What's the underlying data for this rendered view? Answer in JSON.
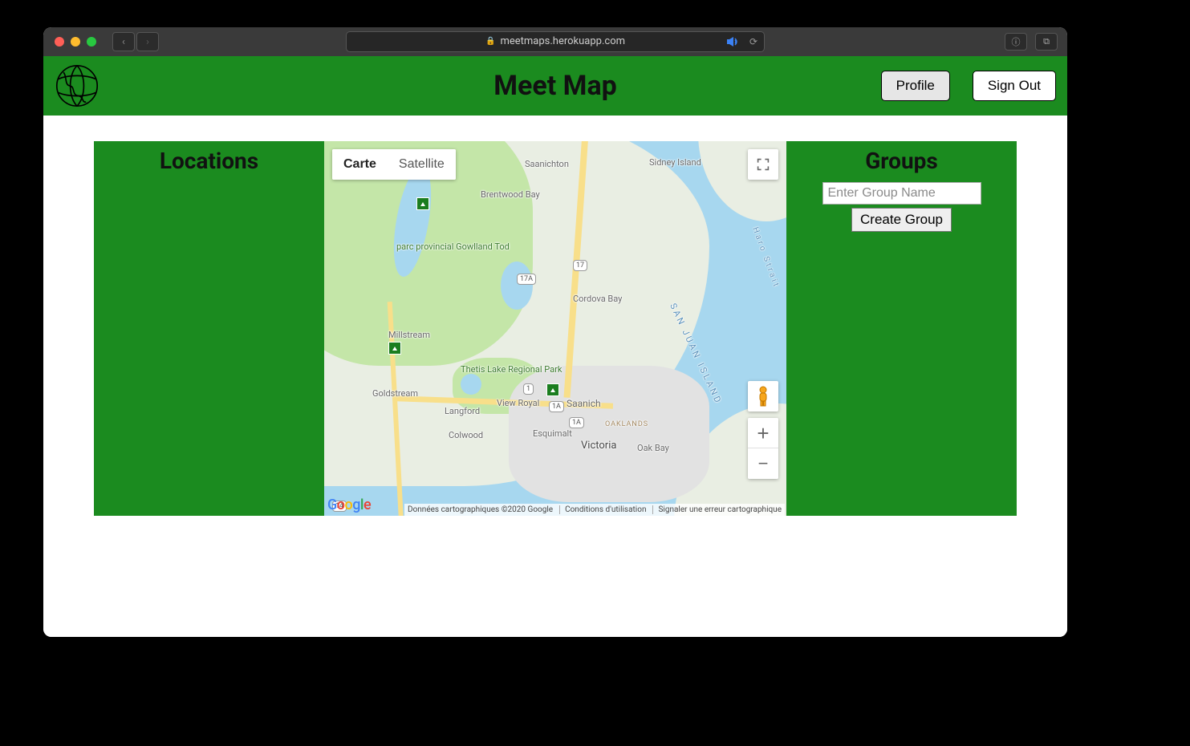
{
  "browser": {
    "url": "meetmaps.herokuapp.com"
  },
  "header": {
    "title": "Meet Map",
    "profile_label": "Profile",
    "signout_label": "Sign Out"
  },
  "left_panel": {
    "title": "Locations"
  },
  "right_panel": {
    "title": "Groups",
    "input_placeholder": "Enter Group Name",
    "create_label": "Create Group"
  },
  "map": {
    "type_map": "Carte",
    "type_sat": "Satellite",
    "zoom_in": "+",
    "zoom_out": "−",
    "attribution": "Données cartographiques ©2020 Google",
    "terms": "Conditions d'utilisation",
    "report": "Signaler une erreur cartographique",
    "labels": {
      "saanichton": "Saanichton",
      "sidney_island": "Sidney Island",
      "brentwood": "Brentwood Bay",
      "gowlland": "parc provincial Gowlland Tod",
      "cordova": "Cordova Bay",
      "millstream": "Millstream",
      "thetis": "Thetis Lake Regional Park",
      "goldstream": "Goldstream",
      "view_royal": "View Royal",
      "saanich": "Saanich",
      "langford": "Langford",
      "colwood": "Colwood",
      "esquimalt": "Esquimalt",
      "victoria": "Victoria",
      "oak_bay": "Oak Bay",
      "oaklands": "OAKLANDS",
      "haro": "Haro Strait",
      "san_juan": "SAN JUAN ISLAND",
      "h17": "17",
      "h17a": "17A",
      "h1a": "1A",
      "h1b": "1A",
      "h1c": "1",
      "h14": "14"
    }
  }
}
